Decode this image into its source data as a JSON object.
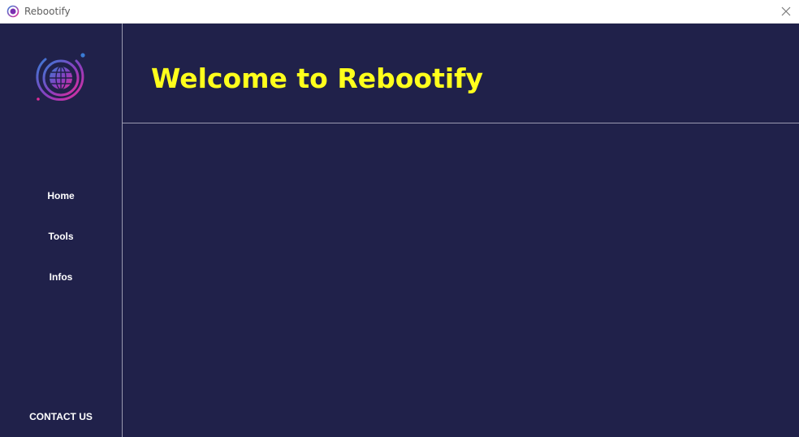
{
  "window": {
    "title": "Rebootify",
    "app_icon": "globe-logo-icon",
    "close_icon": "close-icon"
  },
  "sidebar": {
    "logo": "globe-logo-icon",
    "items": [
      {
        "label": "Home"
      },
      {
        "label": "Tools"
      },
      {
        "label": "Infos"
      }
    ],
    "contact_label": "CONTACT US"
  },
  "main": {
    "heading": "Welcome to Rebootify"
  },
  "colors": {
    "background": "#20214a",
    "heading": "#ffff1c",
    "nav_text": "#ffffff",
    "divider": "#9a9ab0",
    "logo_gradient_start": "#3a7bd5",
    "logo_gradient_end": "#e02c9a"
  }
}
